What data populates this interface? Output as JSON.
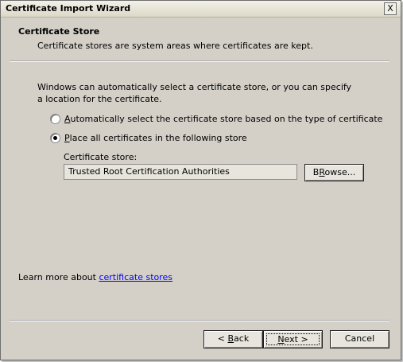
{
  "window": {
    "title": "Certificate Import Wizard",
    "close_label": "X"
  },
  "header": {
    "title": "Certificate Store",
    "subtitle": "Certificate stores are system areas where certificates are kept."
  },
  "intro": "Windows can automatically select a certificate store, or you can specify a location for the certificate.",
  "options": [
    {
      "label_key": "A",
      "label_rest": "utomatically select the certificate store based on the type of certificate",
      "checked": false
    },
    {
      "label_key": "P",
      "label_rest": "lace all certificates in the following store",
      "checked": true
    }
  ],
  "store": {
    "label": "Certificate store:",
    "value": "Trusted Root Certification Authorities",
    "browse_key": "R",
    "browse_pre": "B",
    "browse_rest": "owse..."
  },
  "learn_more": {
    "text": "Learn more about ",
    "link": "certificate stores"
  },
  "footer": {
    "back_pre": "< ",
    "back_key": "B",
    "back_rest": "ack",
    "next_key": "N",
    "next_rest": "ext >",
    "cancel": "Cancel"
  }
}
